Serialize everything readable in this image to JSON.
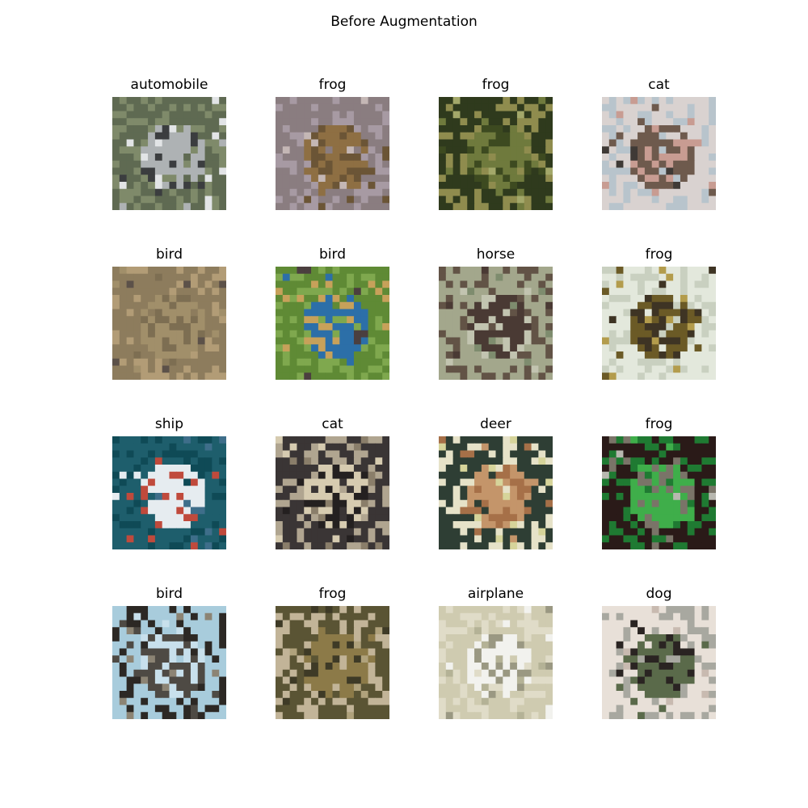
{
  "figure": {
    "title": "Before Augmentation"
  },
  "panels": [
    {
      "label": "automobile",
      "palette": [
        "#5f6a52",
        "#aeb2b4",
        "#e2e4e6",
        "#3b3d3f",
        "#7f8a6a"
      ]
    },
    {
      "label": "frog",
      "palette": [
        "#8a7d80",
        "#8e6f43",
        "#c4b7b5",
        "#6b5536",
        "#a79aa3"
      ]
    },
    {
      "label": "frog",
      "palette": [
        "#2f3a1d",
        "#6f7a3d",
        "#a3a86a",
        "#3d4a20",
        "#8f8c4e"
      ]
    },
    {
      "label": "cat",
      "palette": [
        "#d9d2d0",
        "#6e5a4d",
        "#3f3a36",
        "#c89c92",
        "#b8c4cc"
      ]
    },
    {
      "label": "bird",
      "palette": [
        "#8d7c5d",
        "#a18f6a",
        "#5c5149",
        "#7d6e52",
        "#b29c76"
      ]
    },
    {
      "label": "bird",
      "palette": [
        "#5f8a35",
        "#2c6fa8",
        "#4b3f3f",
        "#c7a15a",
        "#7fa84e"
      ]
    },
    {
      "label": "horse",
      "palette": [
        "#a3a78c",
        "#4a3a34",
        "#7e8c6e",
        "#c2c4b0",
        "#625346"
      ]
    },
    {
      "label": "frog",
      "palette": [
        "#e3e8dc",
        "#6b5a26",
        "#b39c4c",
        "#3e3424",
        "#c9d0c0"
      ]
    },
    {
      "label": "ship",
      "palette": [
        "#1e5e6c",
        "#e6ecf0",
        "#3e6e8a",
        "#c04a3c",
        "#0f4a56"
      ]
    },
    {
      "label": "cat",
      "palette": [
        "#3a3535",
        "#d6cbb0",
        "#8a7e6a",
        "#242020",
        "#b0a590"
      ]
    },
    {
      "label": "deer",
      "palette": [
        "#2e3e34",
        "#c4956a",
        "#d6d49a",
        "#a67048",
        "#e6e2c8"
      ]
    },
    {
      "label": "frog",
      "palette": [
        "#2a1a18",
        "#3fae4a",
        "#b8b8b0",
        "#7a7468",
        "#1f7a32"
      ]
    },
    {
      "label": "bird",
      "palette": [
        "#a8ccdc",
        "#4e4a44",
        "#8c8474",
        "#c8e0ec",
        "#2c2824"
      ]
    },
    {
      "label": "frog",
      "palette": [
        "#5a5434",
        "#8c7a48",
        "#b0a27c",
        "#3e3a26",
        "#c2b498"
      ]
    },
    {
      "label": "airplane",
      "palette": [
        "#cfcbb0",
        "#f2f2ee",
        "#b4b296",
        "#9a9882",
        "#e0dcc8"
      ]
    },
    {
      "label": "dog",
      "palette": [
        "#e8e0d8",
        "#5a6a4a",
        "#c8bab0",
        "#2a2422",
        "#a8a8a0"
      ]
    }
  ]
}
